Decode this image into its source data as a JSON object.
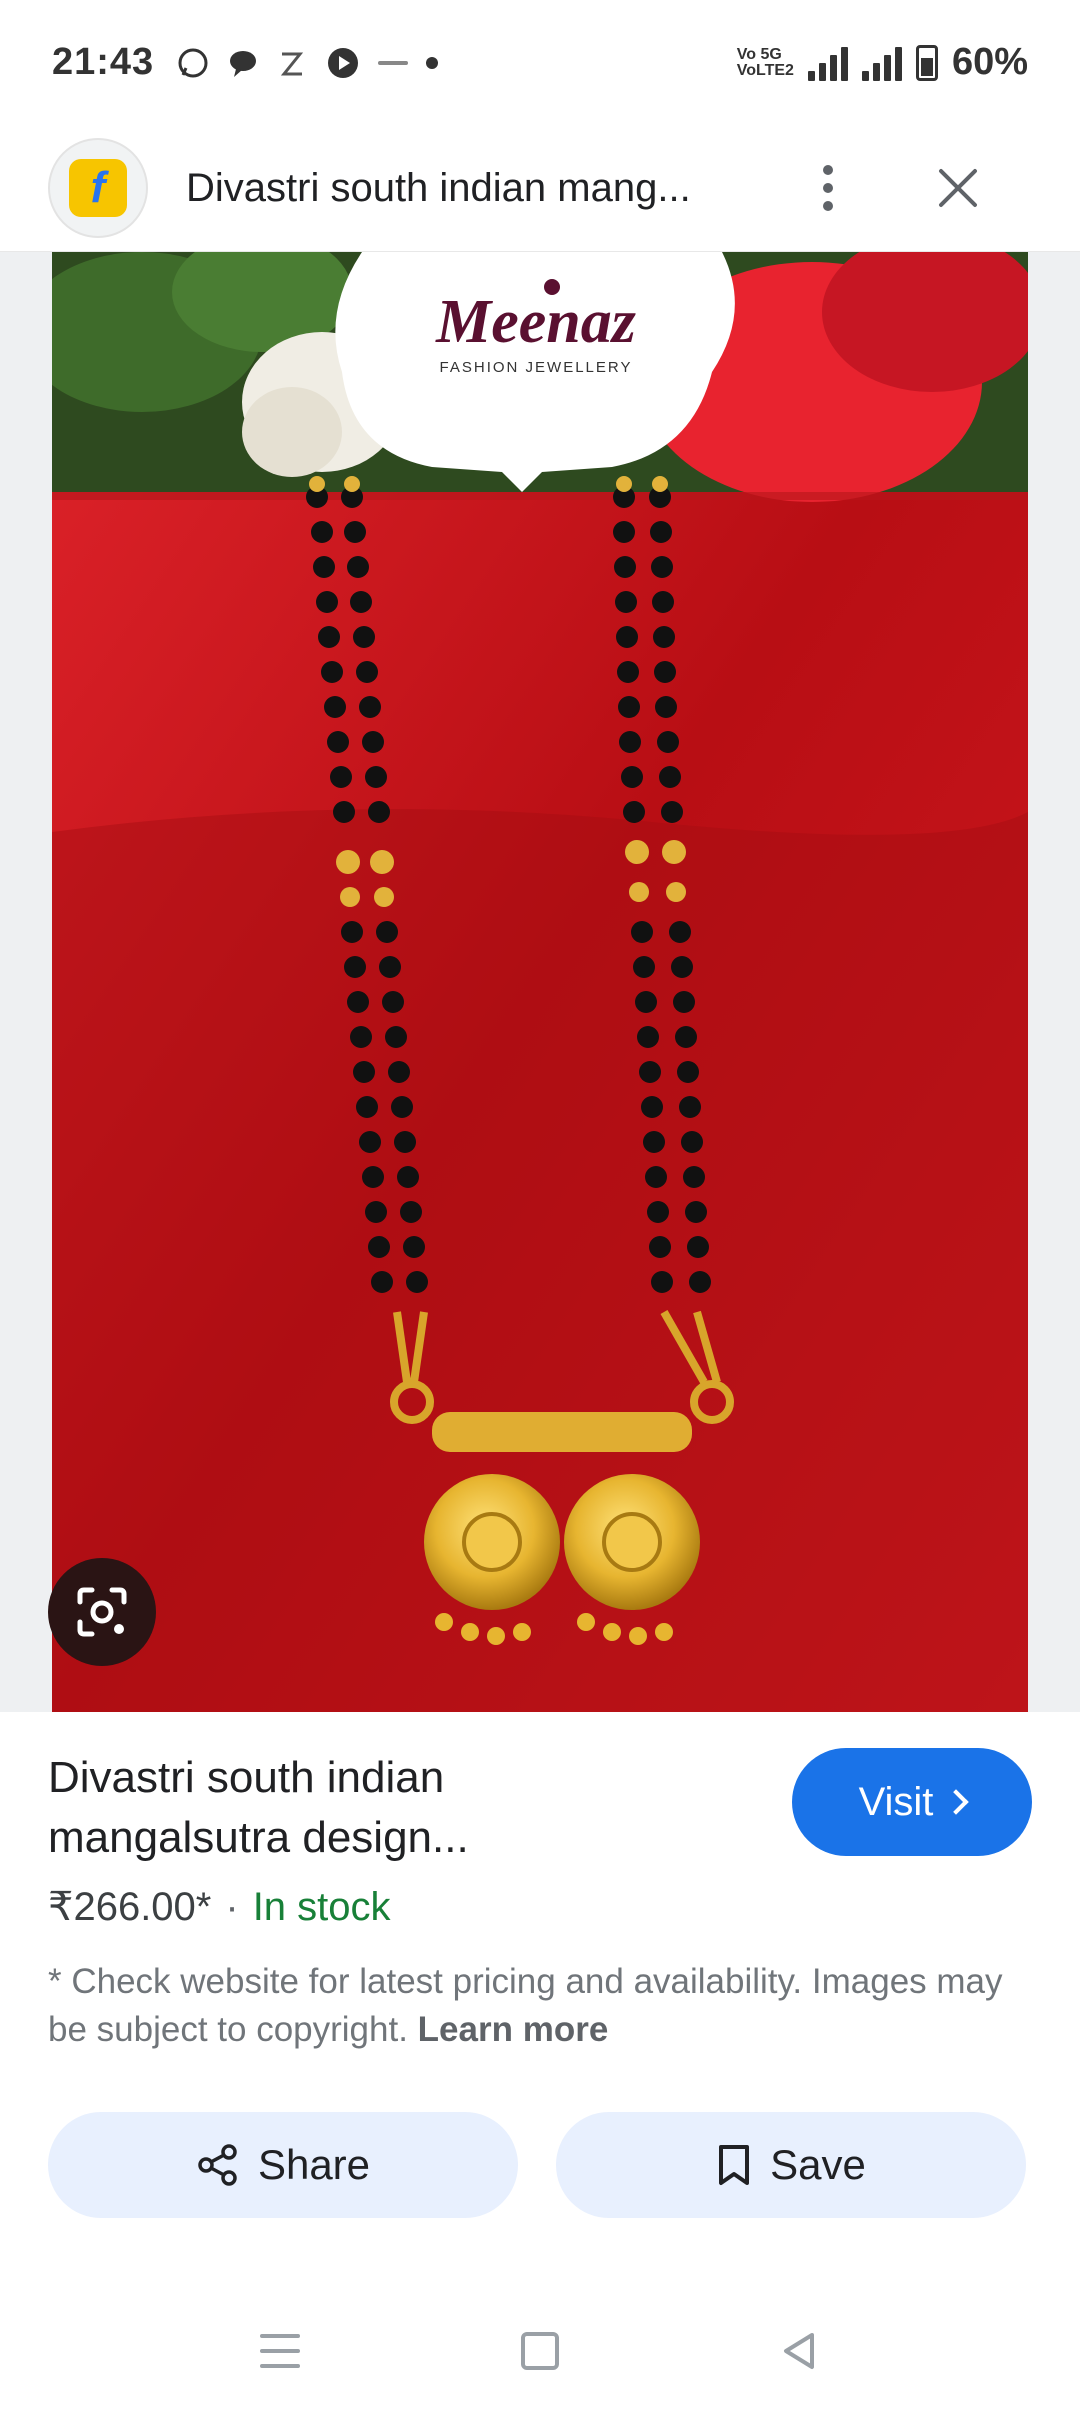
{
  "status_bar": {
    "time": "21:43",
    "network_label_1": "Vo 5G\nVoLTE2",
    "network_label_2": "5G",
    "battery": "60%"
  },
  "header": {
    "title": "Divastri south indian mang...",
    "favicon_letter": "f"
  },
  "image": {
    "brand": "Meenaz",
    "brand_sub": "FASHION JEWELLERY"
  },
  "product": {
    "title": "Divastri south indian mangalsutra design...",
    "visit_label": "Visit",
    "price": "₹266.00*",
    "separator": "·",
    "stock": "In stock",
    "disclaimer": "* Check website for latest pricing and availability. Images may be subject to copyright.",
    "learn_more": "Learn more"
  },
  "actions": {
    "share_label": "Share",
    "save_label": "Save"
  },
  "colors": {
    "accent": "#1a73e8",
    "stock_green": "#188038",
    "chip_bg": "#e8f0fe"
  }
}
